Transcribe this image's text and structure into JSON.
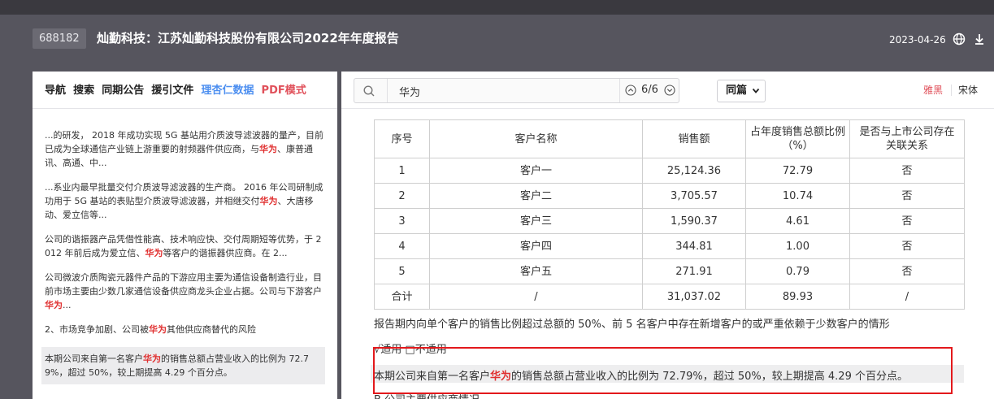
{
  "header": {
    "stock_code": "688182",
    "title": "灿勤科技：江苏灿勤科技股份有限公司2022年年度报告",
    "date": "2023-04-26",
    "icons": [
      "globe-icon",
      "download-icon"
    ]
  },
  "left_panel": {
    "tabs": [
      {
        "label": "导航"
      },
      {
        "label": "搜索"
      },
      {
        "label": "同期公告"
      },
      {
        "label": "援引文件"
      },
      {
        "label": "理杏仁数据"
      },
      {
        "label": "PDF模式"
      }
    ],
    "results": [
      {
        "pre": "...的研发， 2018 年成功实现 5G 基站用介质波导滤波器的量产，目前已成为全球通信产业链上游重要的射频器件供应商，与",
        "hl": "华为",
        "post": "、康普通讯、高通、中..."
      },
      {
        "pre": "...系业内最早批量交付介质波导滤波器的生产商。 2016 年公司研制成功用于 5G 基站的表贴型介质波导滤波器，并相继交付",
        "hl": "华为",
        "post": "、大唐移动、爱立信等..."
      },
      {
        "pre": "公司的谐振器产品凭借性能高、技术响应快、交付周期短等优势，于 2012 年前后成为爱立信、",
        "hl": "华为",
        "post": "等客户的谐振器供应商。在 2..."
      },
      {
        "pre": "公司微波介质陶瓷元器件产品的下游应用主要为通信设备制造行业，目前市场主要由少数几家通信设备供应商龙头企业占据。公司与下游客户",
        "hl": "华为",
        "post": "..."
      },
      {
        "pre": "2、市场竞争加剧、公司被",
        "hl": "华为",
        "post": "其他供应商替代的风险"
      },
      {
        "pre": "本期公司来自第一名客户",
        "hl": "华为",
        "post": "的销售总额占营业收入的比例为 72.79%，超过 50%，较上期提高 4.29 个百分点。"
      }
    ]
  },
  "toolbar": {
    "search_value": "华为",
    "match_count": "6/6",
    "scope_label": "同篇",
    "font_yahei": "雅黑",
    "font_song": "宋体"
  },
  "table": {
    "headers": [
      "序号",
      "客户名称",
      "销售额",
      "占年度销售总额比例（%）",
      "是否与上市公司存在关联关系"
    ],
    "rows": [
      [
        "1",
        "客户一",
        "25,124.36",
        "72.79",
        "否"
      ],
      [
        "2",
        "客户二",
        "3,705.57",
        "10.74",
        "否"
      ],
      [
        "3",
        "客户三",
        "1,590.37",
        "4.61",
        "否"
      ],
      [
        "4",
        "客户四",
        "344.81",
        "1.00",
        "否"
      ],
      [
        "5",
        "客户五",
        "271.91",
        "0.79",
        "否"
      ],
      [
        "合计",
        "/",
        "31,037.02",
        "89.93",
        "/"
      ]
    ]
  },
  "doc": {
    "note": "报告期内向单个客户的销售比例超过总额的 50%、前 5 名客户中存在新增客户的或严重依赖于少数客户的情形",
    "check": "√适用 □不适用",
    "highlight_pre": "本期公司来自第一名客户",
    "highlight_hl": "华为",
    "highlight_post": "的销售总额占营业收入的比例为 72.79%，超过 50%，较上期提高 4.29 个百分点。",
    "cutoff": "B.公司主要供应商情况"
  }
}
